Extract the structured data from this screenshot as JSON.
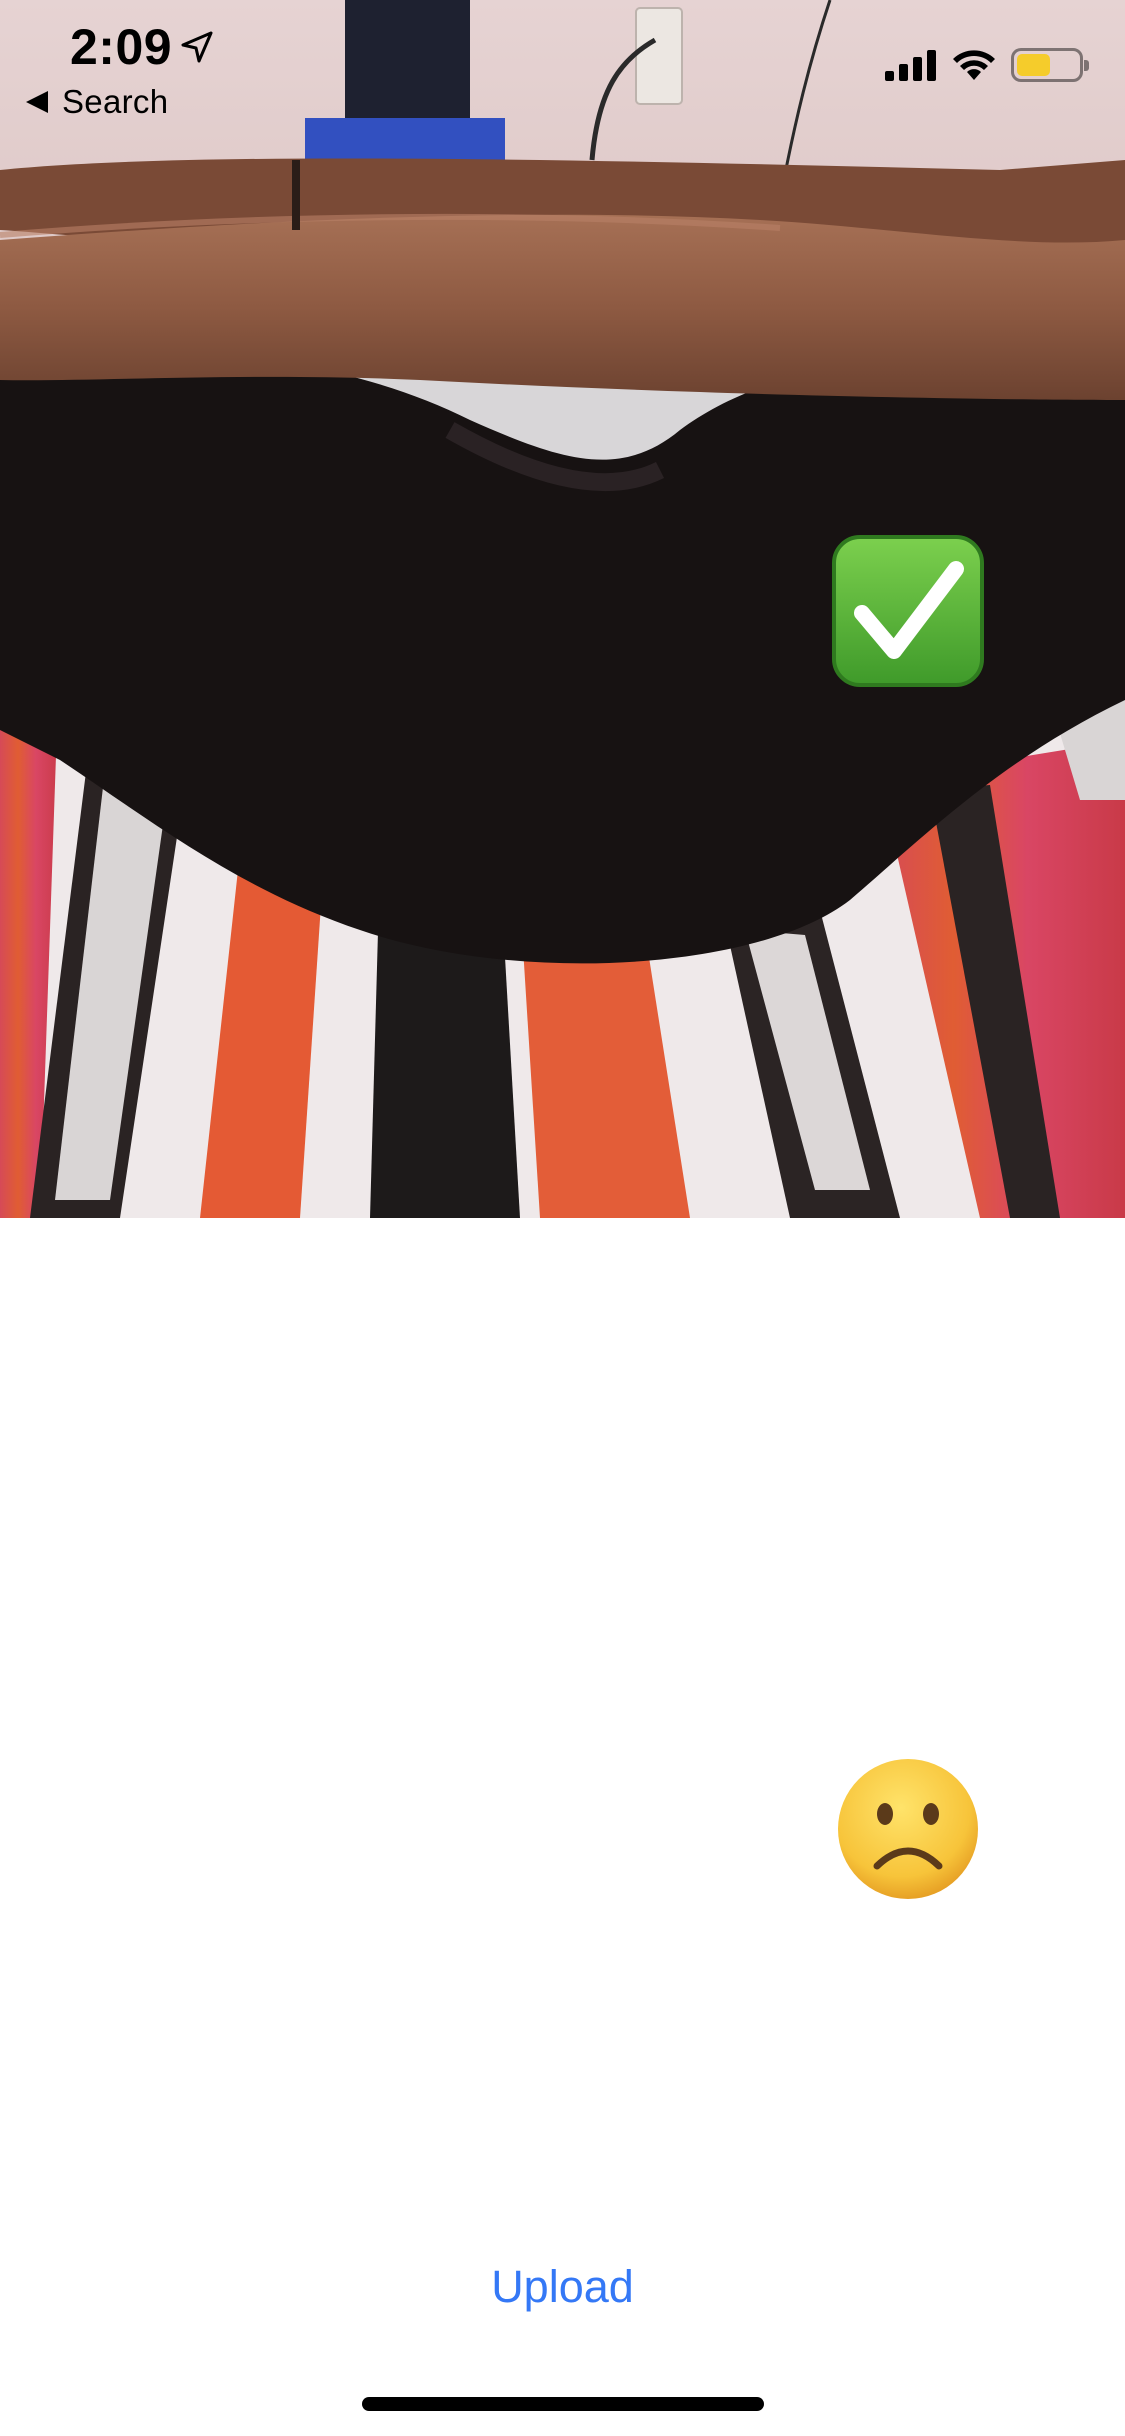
{
  "status_bar": {
    "time": "2:09",
    "back_label": "Search",
    "battery_level": 0.55,
    "battery_color": "#f5cc2b",
    "icons": [
      "location-arrow-icon",
      "cellular-signal-icon",
      "wifi-icon",
      "battery-icon"
    ]
  },
  "photo": {
    "subject": "camera-frame"
  },
  "indicators": {
    "check_icon": "green-check-emoji",
    "sad_icon": "frowning-face-emoji"
  },
  "actions": {
    "upload_label": "Upload"
  },
  "colors": {
    "link_blue": "#3478f6",
    "check_green": "#5fba3d"
  }
}
